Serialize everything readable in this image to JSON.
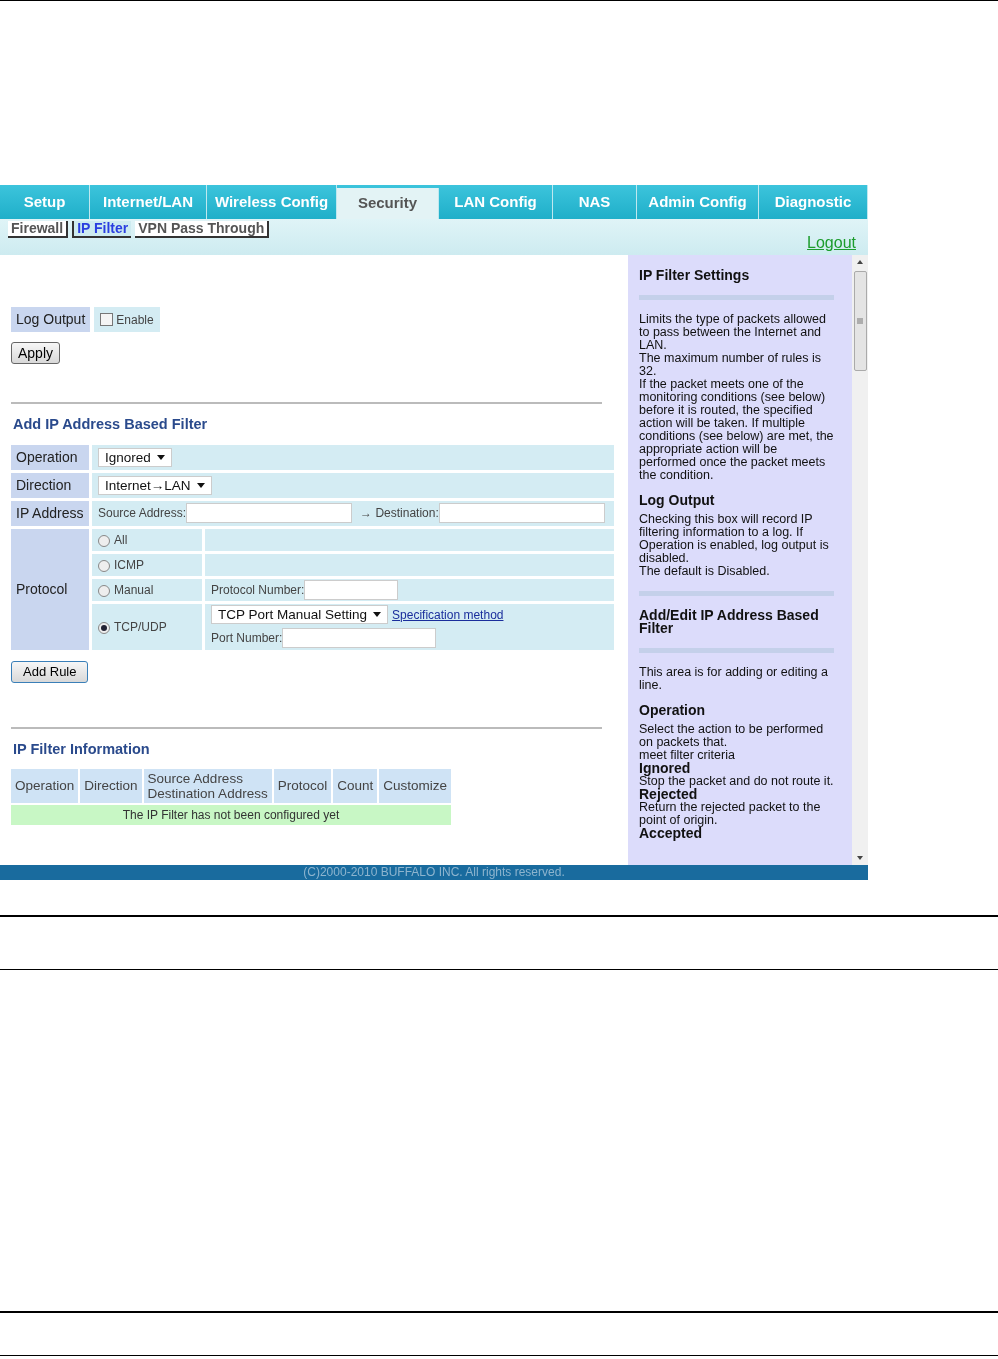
{
  "tabs": [
    {
      "label": "Setup",
      "selected": false
    },
    {
      "label": "Internet/LAN",
      "selected": false
    },
    {
      "label": "Wireless Config",
      "selected": false
    },
    {
      "label": "Security",
      "selected": true
    },
    {
      "label": "LAN Config",
      "selected": false
    },
    {
      "label": "NAS",
      "selected": false
    },
    {
      "label": "Admin Config",
      "selected": false
    },
    {
      "label": "Diagnostic",
      "selected": false
    }
  ],
  "subtabs": [
    {
      "label": "Firewall",
      "selected": false
    },
    {
      "label": "IP Filter",
      "selected": true
    },
    {
      "label": "VPN Pass Through",
      "selected": false
    }
  ],
  "logout": "Logout",
  "log_output": {
    "label": "Log Output",
    "checkbox_label": "Enable",
    "checked": false
  },
  "apply_button": "Apply",
  "add_filter": {
    "title": "Add IP Address Based Filter",
    "operation": {
      "label": "Operation",
      "value": "Ignored"
    },
    "direction": {
      "label": "Direction",
      "value": "Internet→LAN"
    },
    "ip_address": {
      "label": "IP Address",
      "source_label": "Source Address:",
      "destination_label": "→ Destination:"
    },
    "protocol": {
      "label": "Protocol",
      "options": [
        {
          "kind": "plain",
          "label": "All",
          "selected": false
        },
        {
          "kind": "plain",
          "label": "ICMP",
          "selected": false
        },
        {
          "kind": "number",
          "label": "Manual",
          "selected": false,
          "field_label": "Protocol Number:"
        },
        {
          "kind": "ports",
          "label": "TCP/UDP",
          "selected": true,
          "port_setting": "TCP Port Manual Setting",
          "link": "Specification method",
          "field_label": "Port Number:"
        }
      ]
    },
    "add_button": "Add Rule"
  },
  "filter_info": {
    "title": "IP Filter Information",
    "columns": [
      "Operation",
      "Direction",
      "Source Address\nDestination Address",
      "Protocol",
      "Count",
      "Customize"
    ],
    "empty_message": "The IP Filter has not been configured yet"
  },
  "help": [
    {
      "kind": "heading",
      "text": "IP Filter Settings"
    },
    {
      "kind": "divider"
    },
    {
      "kind": "text",
      "text": "Limits the type of packets allowed to pass between the Internet and LAN."
    },
    {
      "kind": "text",
      "text": "The maximum number of rules is 32."
    },
    {
      "kind": "text",
      "text": "If the packet meets one of the monitoring conditions (see below) before it is routed, the specified action will be taken. If multiple conditions (see below) are met, the appropriate action will be performed once the packet meets the condition."
    },
    {
      "kind": "heading",
      "text": "Log Output"
    },
    {
      "kind": "text",
      "text": "Checking this box will record IP filtering information to a log. If Operation is enabled, log output is disabled."
    },
    {
      "kind": "text",
      "text": "The default is Disabled."
    },
    {
      "kind": "divider"
    },
    {
      "kind": "heading",
      "text": "Add/Edit IP Address Based Filter"
    },
    {
      "kind": "divider"
    },
    {
      "kind": "text",
      "text": "This area is for adding or editing a line."
    },
    {
      "kind": "heading",
      "text": "Operation"
    },
    {
      "kind": "text",
      "text": "Select the action to be performed on packets that."
    },
    {
      "kind": "text",
      "text": "meet filter criteria"
    },
    {
      "kind": "term",
      "text": "Ignored"
    },
    {
      "kind": "text",
      "text": "Stop the packet and do not route it."
    },
    {
      "kind": "term",
      "text": "Rejected"
    },
    {
      "kind": "text",
      "text": "Return the rejected packet to the point of origin."
    },
    {
      "kind": "term",
      "text": "Accepted"
    }
  ],
  "footer": "(C)2000-2010 BUFFALO INC. All rights reserved."
}
